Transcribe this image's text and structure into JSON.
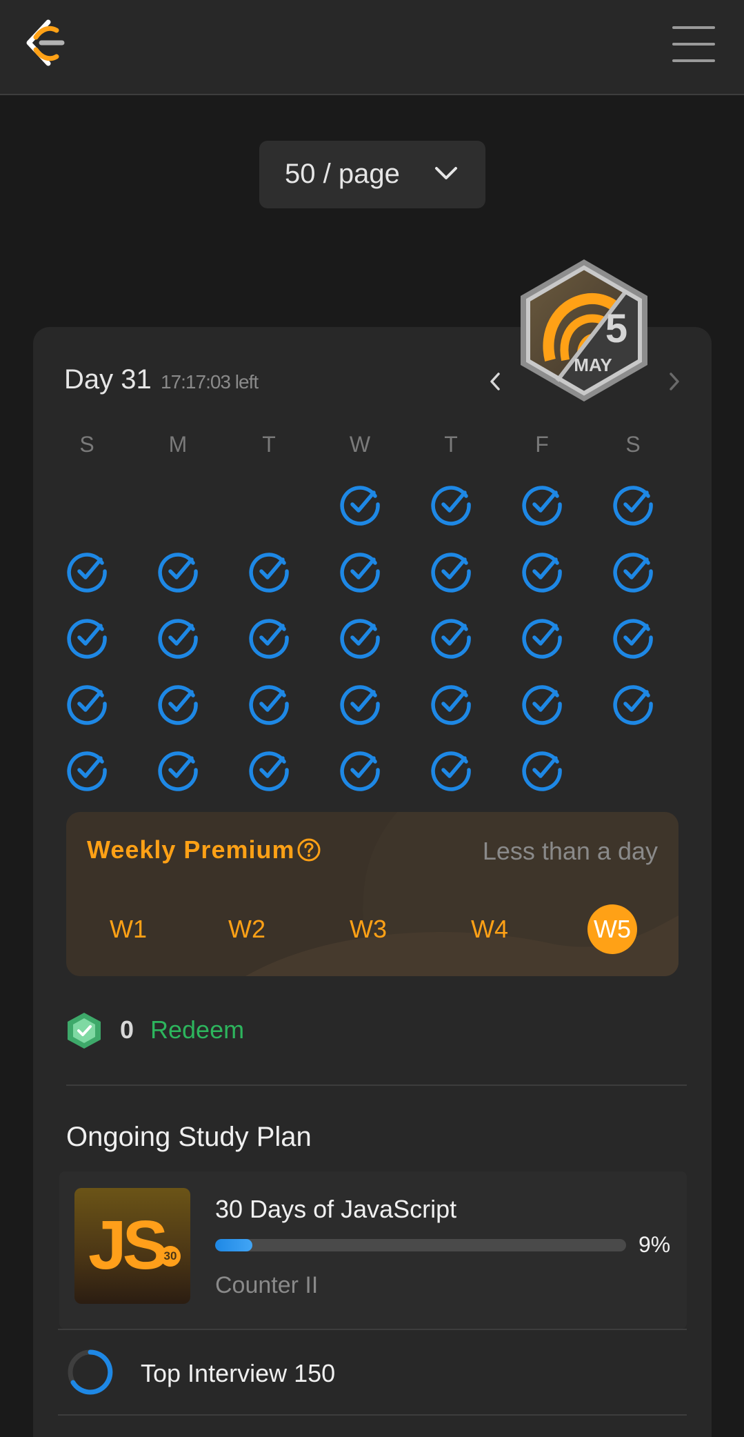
{
  "page_size": {
    "label": "50 / page"
  },
  "calendar": {
    "title": "Day 31",
    "time_left": "17:17:03 left",
    "badge": {
      "day": "5",
      "month": "MAY"
    },
    "weekdays": [
      "S",
      "M",
      "T",
      "W",
      "T",
      "F",
      "S"
    ]
  },
  "weekly_premium": {
    "title": "Weekly Premium",
    "status": "Less than a day",
    "weeks": [
      "W1",
      "W2",
      "W3",
      "W4",
      "W5"
    ],
    "active_week": "W5"
  },
  "coins": {
    "count": "0",
    "redeem_label": "Redeem"
  },
  "study_plan": {
    "section_title": "Ongoing Study Plan",
    "current": {
      "thumb_text": "JS",
      "thumb_badge": "30",
      "name": "30 Days of JavaScript",
      "progress": 0.09,
      "progress_label": "9%",
      "subtitle": "Counter II"
    },
    "other": {
      "name": "Top Interview 150"
    }
  },
  "colors": {
    "accent": "#ffa116",
    "check": "#1e88e5",
    "redeem": "#2db55d"
  }
}
